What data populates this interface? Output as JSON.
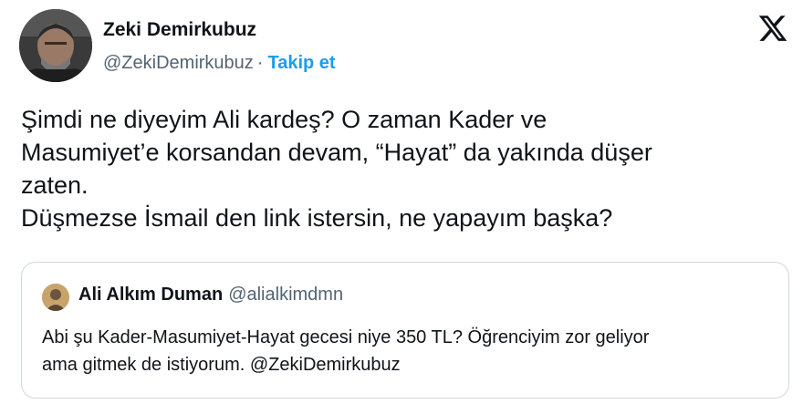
{
  "tweet": {
    "author": {
      "name": "Zeki Demirkubuz",
      "handle": "@ZekiDemirkubuz",
      "separator": "·",
      "follow_label": "Takip et"
    },
    "text_lines": [
      "Şimdi ne diyeyim Ali kardeş? O zaman Kader ve",
      "Masumiyet’e korsandan devam, “Hayat” da yakında düşer",
      "zaten.",
      "Düşmezse İsmail den link istersin, ne yapayım başka?"
    ],
    "quoted": {
      "name": "Ali Alkım Duman",
      "handle": "@alialkimdmn",
      "text_lines": [
        "Abi şu Kader-Masumiyet-Hayat gecesi niye 350 TL? Öğrenciyim zor geliyor",
        "ama gitmek de istiyorum. @ZekiDemirkubuz"
      ]
    }
  },
  "icons": {
    "platform_logo": "x-logo-icon"
  },
  "colors": {
    "link": "#1d9bf0",
    "text": "#0f1419",
    "secondary": "#536471",
    "border": "#cfd9de"
  }
}
